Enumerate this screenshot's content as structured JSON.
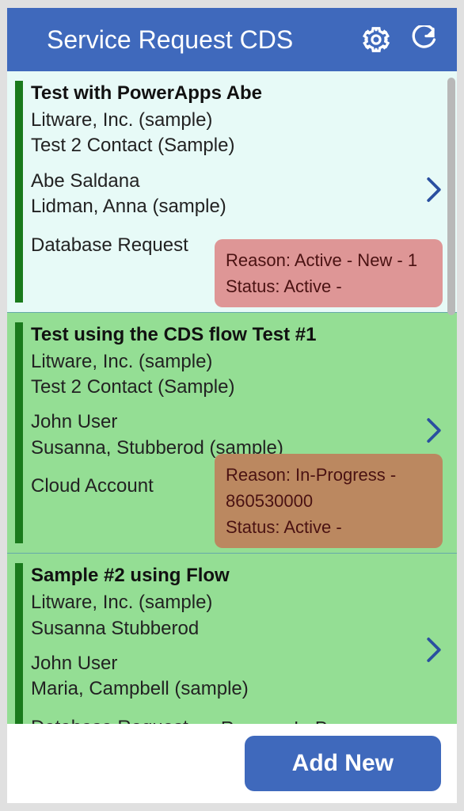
{
  "header": {
    "title": "Service Request CDS"
  },
  "records": [
    {
      "bg": "bg-light",
      "title": "Test with PowerApps Abe",
      "company": "Litware, Inc. (sample)",
      "contact": "Test 2 Contact (Sample)",
      "person1": "Abe Saldana",
      "person2": "Lidman, Anna (sample)",
      "type": "Database Request",
      "badge_style": "badge-red",
      "reason": "Reason: Active - New - 1",
      "status": "Status: Active -",
      "inline_reason": ""
    },
    {
      "bg": "bg-green",
      "title": "Test using the CDS flow Test #1",
      "company": "Litware, Inc. (sample)",
      "contact": "Test 2 Contact (Sample)",
      "person1": "John User",
      "person2": "Susanna, Stubberod (sample)",
      "type": "Cloud Account",
      "badge_style": "badge-brown",
      "reason": "Reason: In-Progress - 860530000",
      "status": "Status: Active -",
      "inline_reason": ""
    },
    {
      "bg": "bg-green",
      "title": "Sample #2 using Flow",
      "company": "Litware, Inc. (sample)",
      "contact": "Susanna Stubberod",
      "person1": "John User",
      "person2": "Maria, Campbell (sample)",
      "type": "Database Request",
      "badge_style": "",
      "reason": "",
      "status": "",
      "inline_reason": "Reason: In-Progress -"
    }
  ],
  "footer": {
    "add_label": "Add New"
  }
}
